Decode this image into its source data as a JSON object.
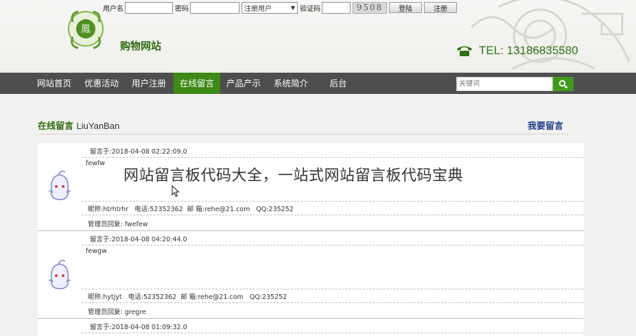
{
  "login": {
    "username_label": "用户名",
    "password_label": "密码",
    "role_selected": "注册用户",
    "captcha_label": "验证码",
    "captcha_code": "9508",
    "login_button": "登陆",
    "register_button": "注册"
  },
  "site": {
    "name": "购物网站",
    "tel": "TEL: 13186835580"
  },
  "nav": {
    "items": [
      "网站首页",
      "优惠活动",
      "用户注册",
      "在线留言",
      "产品产示",
      "系统简介",
      "后台"
    ],
    "active_index": 3
  },
  "search": {
    "placeholder": "关键词"
  },
  "section": {
    "title_cn": "在线留言",
    "title_en": "LiuYanBan",
    "write_link": "我要留言"
  },
  "messages": [
    {
      "date": "留言于:2018-04-08 02:22:09.0",
      "content": "fewfw",
      "nickname_label": "昵称:",
      "nickname": "htrhtrhr",
      "phone_label": "电话:",
      "phone": "52352362",
      "email_label": "邮 箱:",
      "email": "rehe@21.com",
      "qq_label": "QQ:",
      "qq": "235252",
      "reply_label": "管理员回复:",
      "reply": "fwefew"
    },
    {
      "date": "留言于:2018-04-08 04:20:44.0",
      "content": "fewgw",
      "nickname_label": "昵称:",
      "nickname": "hytjyt",
      "phone_label": "电话:",
      "phone": "52352362",
      "email_label": "邮 箱:",
      "email": "rehe@21.com",
      "qq_label": "QQ:",
      "qq": "235252",
      "reply_label": "管理员回复:",
      "reply": "gregre"
    },
    {
      "date": "留言于:2018-04-08 01:09:32.0"
    }
  ],
  "overlay": {
    "caption": "网站留言板代码大全，一站式网站留言板代码宝典"
  },
  "colors": {
    "accent_green": "#3d8a17",
    "nav_bg": "#4d4e4e",
    "link_blue": "#1d3f8a"
  }
}
